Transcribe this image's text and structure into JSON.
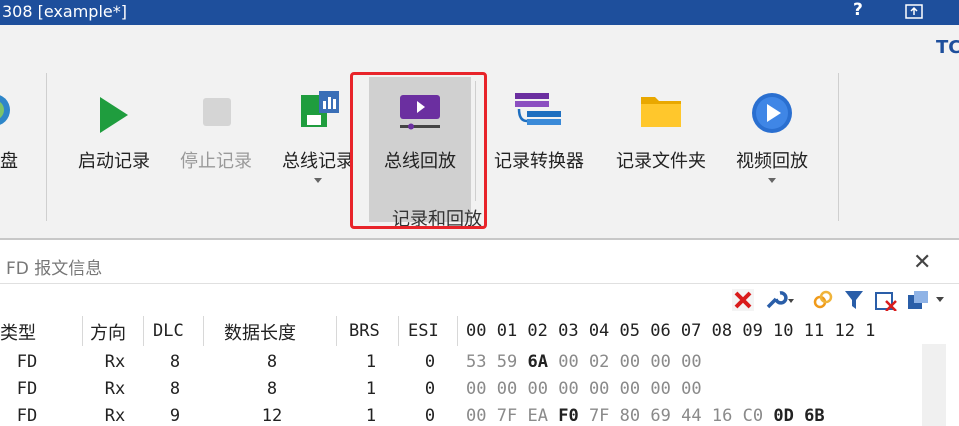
{
  "titlebar": {
    "title": "308 [example*]",
    "help": "?",
    "colors": {
      "background": "#1e4f9c"
    }
  },
  "ribbon": {
    "corner_text": "TC",
    "partial_left_label": "盘",
    "tools": [
      {
        "id": "start",
        "label": "启动记录",
        "icon": "play-icon",
        "enabled": true
      },
      {
        "id": "stop",
        "label": "停止记录",
        "icon": "stop-icon",
        "enabled": false
      },
      {
        "id": "bus-log",
        "label": "总线记录",
        "icon": "bus-log-icon",
        "enabled": true,
        "has_dropdown": true
      },
      {
        "id": "bus-replay",
        "label": "总线回放",
        "icon": "replay-icon",
        "enabled": true,
        "selected": true
      },
      {
        "id": "converter",
        "label": "记录转换器",
        "icon": "converter-icon",
        "enabled": true
      },
      {
        "id": "folder",
        "label": "记录文件夹",
        "icon": "folder-icon",
        "enabled": true
      },
      {
        "id": "video",
        "label": "视频回放",
        "icon": "video-play-icon",
        "enabled": true,
        "has_dropdown": true
      }
    ],
    "group_label": "记录和回放",
    "highlight_color": "#e8242a"
  },
  "panel": {
    "title": "FD 报文信息",
    "close": "✕",
    "toolbar_icons": [
      "clear-icon",
      "settings-wrench-icon",
      "link-icon",
      "filter-icon",
      "clear-filter-icon",
      "export-icon"
    ],
    "columns": [
      "类型",
      "方向",
      "DLC",
      "数据长度",
      "BRS",
      "ESI"
    ],
    "hex_header": "00 01 02 03 04 05 06 07 08 09 10 11 12 1",
    "rows": [
      {
        "type": "FD",
        "dir": "Rx",
        "dlc": "8",
        "len": "8",
        "brs": "1",
        "esi": "0",
        "bytes": [
          "53",
          "59",
          "6A",
          "00",
          "02",
          "00",
          "00",
          "00"
        ],
        "bold": [
          2
        ]
      },
      {
        "type": "FD",
        "dir": "Rx",
        "dlc": "8",
        "len": "8",
        "brs": "1",
        "esi": "0",
        "bytes": [
          "00",
          "00",
          "00",
          "00",
          "00",
          "00",
          "00",
          "00"
        ],
        "bold": []
      },
      {
        "type": "FD",
        "dir": "Rx",
        "dlc": "9",
        "len": "12",
        "brs": "1",
        "esi": "0",
        "bytes": [
          "00",
          "7F",
          "EA",
          "F0",
          "7F",
          "80",
          "69",
          "44",
          "16",
          "C0",
          "0D",
          "6B"
        ],
        "bold": [
          3,
          10,
          11
        ]
      }
    ]
  }
}
